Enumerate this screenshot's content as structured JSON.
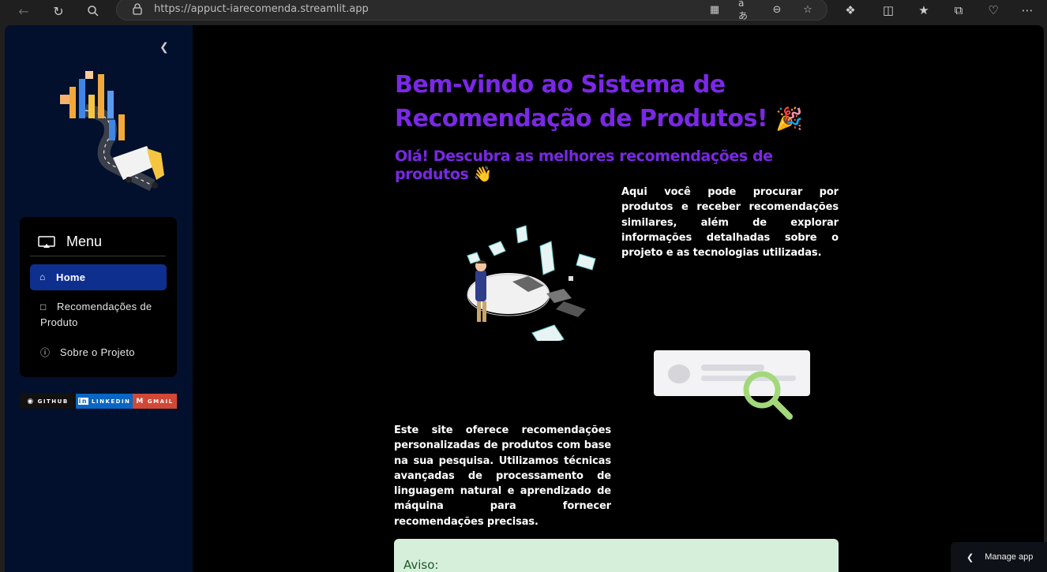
{
  "browser": {
    "url": "https://appuct-iarecomenda.streamlit.app"
  },
  "sidebar": {
    "menu_title": "Menu",
    "items": [
      {
        "label": "Home",
        "icon": "house-icon",
        "active": true
      },
      {
        "label": "Recomendações de Produto",
        "icon": "box-icon",
        "active": false
      },
      {
        "label": "Sobre o Projeto",
        "icon": "info-circle-icon",
        "active": false
      }
    ],
    "badges": [
      {
        "label": "GITHUB",
        "color": "#121011"
      },
      {
        "label": "LINKEDIN",
        "color": "#0a66c2"
      },
      {
        "label": "GMAIL",
        "color": "#d14836"
      }
    ]
  },
  "main": {
    "title": "Bem-vindo ao Sistema de Recomendação de Produtos!",
    "title_emoji": "🎉",
    "subtitle": "Olá! Descubra as melhores recomendações de produtos",
    "subtitle_emoji": "👋",
    "para1": "Aqui você pode procurar por produtos e receber recomendações similares, além de explorar informações detalhadas sobre o projeto e as tecnologias utilizadas.",
    "para2": "Este site oferece recomendações personalizadas de produtos com base na sua pesquisa. Utilizamos técnicas avançadas de processamento de linguagem natural e aprendizado de máquina para fornecer recomendações precisas.",
    "aviso_title": "Aviso:"
  },
  "manage_app": "Manage app",
  "colors": {
    "accent": "#7a28e6",
    "sidebar_bg": "#02102d",
    "active_item": "#0f2f8f",
    "aviso_bg": "#d6efdb"
  }
}
